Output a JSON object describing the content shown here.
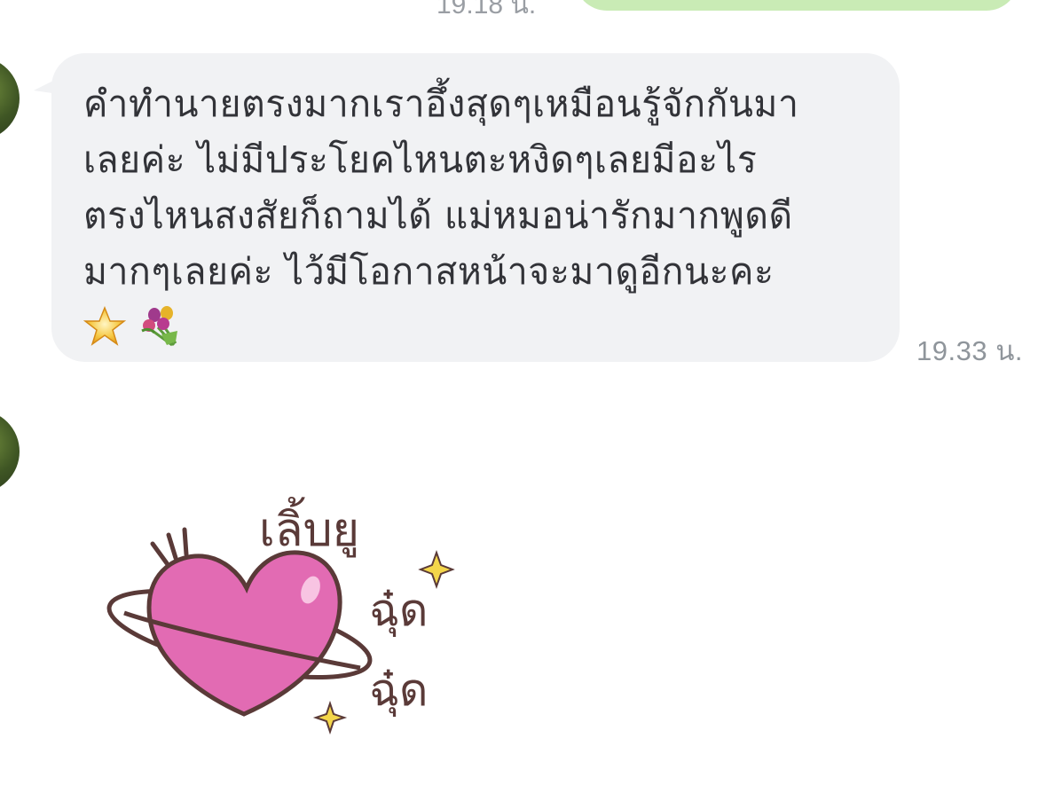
{
  "previous_message": {
    "time": "19.18 น."
  },
  "message": {
    "text_lines": [
      "คำทำนายตรงมากเราอึ้งสุดๆเหมือนรู้จักกันมา",
      "เลยค่ะ ไม่มีประโยคไหนตะหงิดๆเลยมีอะไร",
      "ตรงไหนสงสัยก็ถามได้ แม่หมอน่ารักมากพูดดี",
      "มากๆเลยค่ะ ไว้มีโอกาสหน้าจะมาดูอีกนะคะ"
    ],
    "emojis": [
      "star-emoji",
      "bouquet-emoji"
    ],
    "time": "19.33 น."
  },
  "sticker": {
    "caption": "เลิ้บยู ฉุ๋ด ฉุ๋ด",
    "icon": "heart-planet-sticker",
    "colors": {
      "heart": "#e26bb3",
      "outline": "#5a3a38",
      "sparkle": "#f4d64a"
    }
  },
  "colors": {
    "incoming_bubble": "#f1f2f4",
    "outgoing_bubble": "#c9ebb5",
    "timestamp": "#8f959b"
  }
}
